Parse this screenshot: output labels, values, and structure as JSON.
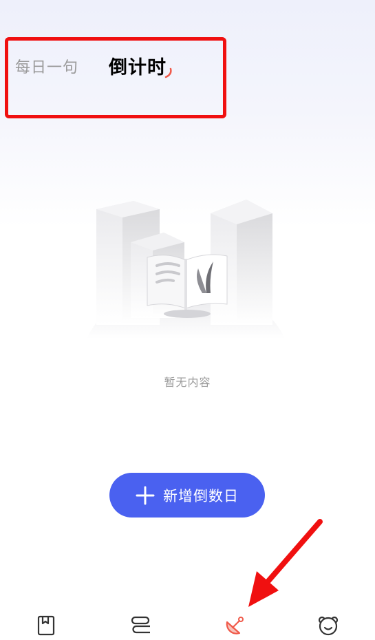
{
  "tabs": {
    "daily_quote": "每日一句",
    "countdown": "倒计时"
  },
  "empty_state": {
    "message": "暂无内容"
  },
  "add_button": {
    "label": "新增倒数日"
  },
  "bottom_nav": [
    {
      "icon": "bookmark-book-icon",
      "active": false
    },
    {
      "icon": "stack-layers-icon",
      "active": false
    },
    {
      "icon": "satellite-dish-icon",
      "active": true
    },
    {
      "icon": "bear-face-icon",
      "active": false
    }
  ],
  "colors": {
    "accent": "#4a61f0",
    "active_tab_indicator": "#f05a4a",
    "annotation": "#f01010"
  }
}
